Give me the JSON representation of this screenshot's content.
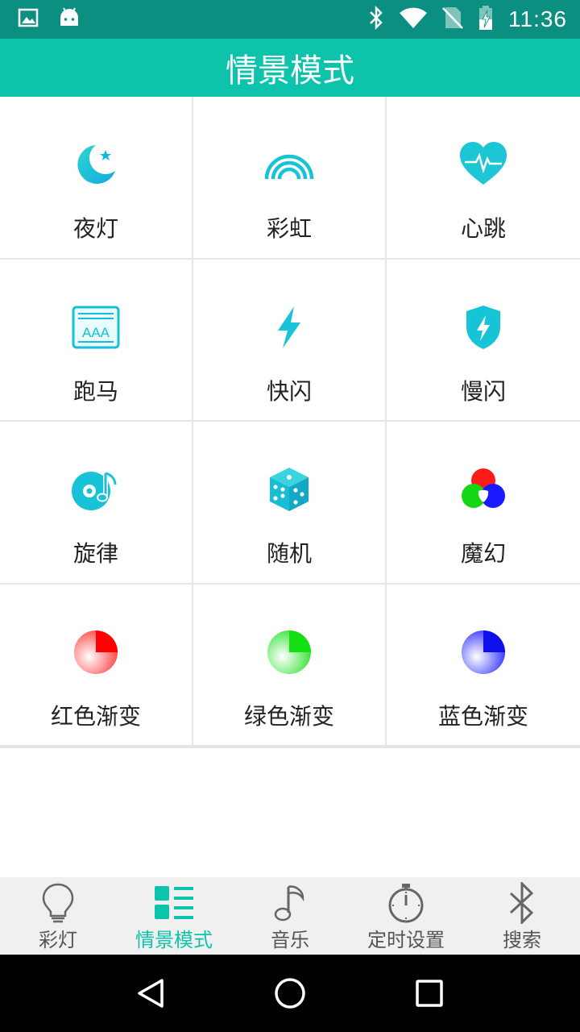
{
  "status_bar": {
    "time": "11:36",
    "left_icons": [
      "image-icon",
      "android-icon"
    ],
    "right_icons": [
      "bluetooth-icon",
      "wifi-icon",
      "no-sim-icon",
      "battery-charging-icon"
    ]
  },
  "app_bar": {
    "title": "情景模式",
    "color": "#0ec3ab"
  },
  "modes": [
    {
      "label": "夜灯",
      "icon": "moon-star-icon"
    },
    {
      "label": "彩虹",
      "icon": "rainbow-icon"
    },
    {
      "label": "心跳",
      "icon": "heartbeat-icon"
    },
    {
      "label": "跑马",
      "icon": "marquee-icon"
    },
    {
      "label": "快闪",
      "icon": "lightning-icon"
    },
    {
      "label": "慢闪",
      "icon": "shield-lightning-icon"
    },
    {
      "label": "旋律",
      "icon": "melody-disc-icon"
    },
    {
      "label": "随机",
      "icon": "dice-icon"
    },
    {
      "label": "魔幻",
      "icon": "rgb-circles-icon"
    },
    {
      "label": "红色渐变",
      "icon": "red-gradient-icon"
    },
    {
      "label": "绿色渐变",
      "icon": "green-gradient-icon"
    },
    {
      "label": "蓝色渐变",
      "icon": "blue-gradient-icon"
    }
  ],
  "marquee_text": "AAA",
  "bottom_nav": [
    {
      "label": "彩灯",
      "icon": "bulb-icon",
      "active": false
    },
    {
      "label": "情景模式",
      "icon": "list-grid-icon",
      "active": true
    },
    {
      "label": "音乐",
      "icon": "music-note-icon",
      "active": false
    },
    {
      "label": "定时设置",
      "icon": "stopwatch-icon",
      "active": false
    },
    {
      "label": "搜索",
      "icon": "bluetooth-icon",
      "active": false
    }
  ],
  "system_nav": [
    "back-icon",
    "home-icon",
    "recents-icon"
  ],
  "colors": {
    "accent": "#0ec3ab",
    "status_bar": "#0a8f80",
    "icon_teal": "#14c4d8"
  }
}
